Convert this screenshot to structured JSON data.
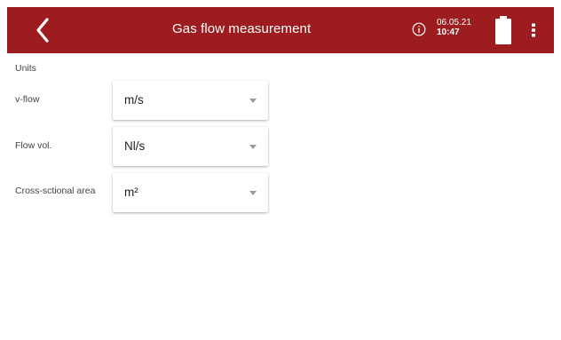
{
  "header": {
    "title": "Gas flow measurement",
    "date": "06.05.21",
    "time": "10:47",
    "color": "#9d1c20",
    "icons": [
      "back-arrow-icon",
      "info-icon",
      "battery-icon",
      "more-vertical-icon"
    ]
  },
  "units": {
    "title": "Units",
    "rows": [
      {
        "label": "v-flow",
        "value": "m/s"
      },
      {
        "label": "Flow vol.",
        "value": "Nl/s"
      },
      {
        "label": "Cross-sctional area",
        "value": "m²"
      }
    ]
  }
}
